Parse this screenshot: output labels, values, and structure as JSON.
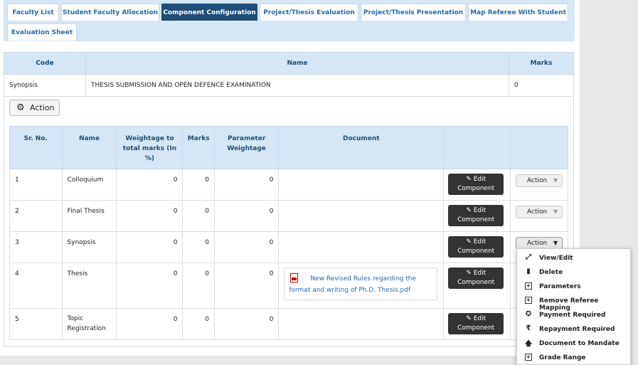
{
  "tabs": [
    {
      "label": "Faculty List",
      "active": false
    },
    {
      "label": "Student Faculty Allocation",
      "active": false
    },
    {
      "label": "Component Configuration",
      "active": true
    },
    {
      "label": "Project/Thesis Evaluation",
      "active": false
    },
    {
      "label": "Project/Thesis Presentation",
      "active": false
    },
    {
      "label": "Map Referee With Student",
      "active": false
    },
    {
      "label": "Evaluation Sheet",
      "active": false
    }
  ],
  "summary": {
    "headers": {
      "code": "Code",
      "name": "Name",
      "marks": "Marks"
    },
    "row": {
      "code": "Synopsis",
      "name": "THESIS SUBMISSION AND OPEN DEFENCE EXAMINATION",
      "marks": "0"
    }
  },
  "action_button": {
    "label": "Action"
  },
  "components": {
    "headers": {
      "sr": "Sr. No.",
      "name": "Name",
      "weightage": "Weightage to total marks (In %)",
      "marks": "Marks",
      "param": "Parameter Weightage",
      "document": "Document"
    },
    "rows": [
      {
        "sr": "1",
        "name": "Colloquium",
        "weightage": "0",
        "marks": "0",
        "param": "0",
        "document": "",
        "edit": "Edit Component",
        "action": "Action"
      },
      {
        "sr": "2",
        "name": "Final Thesis",
        "weightage": "0",
        "marks": "0",
        "param": "0",
        "document": "",
        "edit": "Edit Component",
        "action": "Action"
      },
      {
        "sr": "3",
        "name": "Synopsis",
        "weightage": "0",
        "marks": "0",
        "param": "0",
        "document": "",
        "edit": "Edit Component",
        "action": "Action"
      },
      {
        "sr": "4",
        "name": "Thesis",
        "weightage": "0",
        "marks": "0",
        "param": "0",
        "document": "New Revised Rules regarding the format and writing of Ph.D. Thesis.pdf",
        "edit": "Edit Component",
        "action": ""
      },
      {
        "sr": "5",
        "name": "Topic Registration",
        "weightage": "0",
        "marks": "0",
        "param": "0",
        "document": "",
        "edit": "Edit Component",
        "action": ""
      }
    ]
  },
  "dropdown_menu": [
    {
      "label": "View/Edit",
      "icon": "expand-icon"
    },
    {
      "label": "Delete",
      "icon": "trash-icon"
    },
    {
      "label": "Parameters",
      "icon": "plus-box-icon"
    },
    {
      "label": "Remove Referee Mapping",
      "icon": "plus-box-icon"
    },
    {
      "label": "Payment Required",
      "icon": "badge-check-icon"
    },
    {
      "label": "Repayment Required",
      "icon": "rupee-icon"
    },
    {
      "label": "Document to Mandate",
      "icon": "arrow-up-icon"
    },
    {
      "label": "Grade Range",
      "icon": "plus-box-icon"
    }
  ],
  "colors": {
    "accent": "#1f4e79",
    "header_bg": "#d6e6f5",
    "link": "#2a6aa8"
  }
}
